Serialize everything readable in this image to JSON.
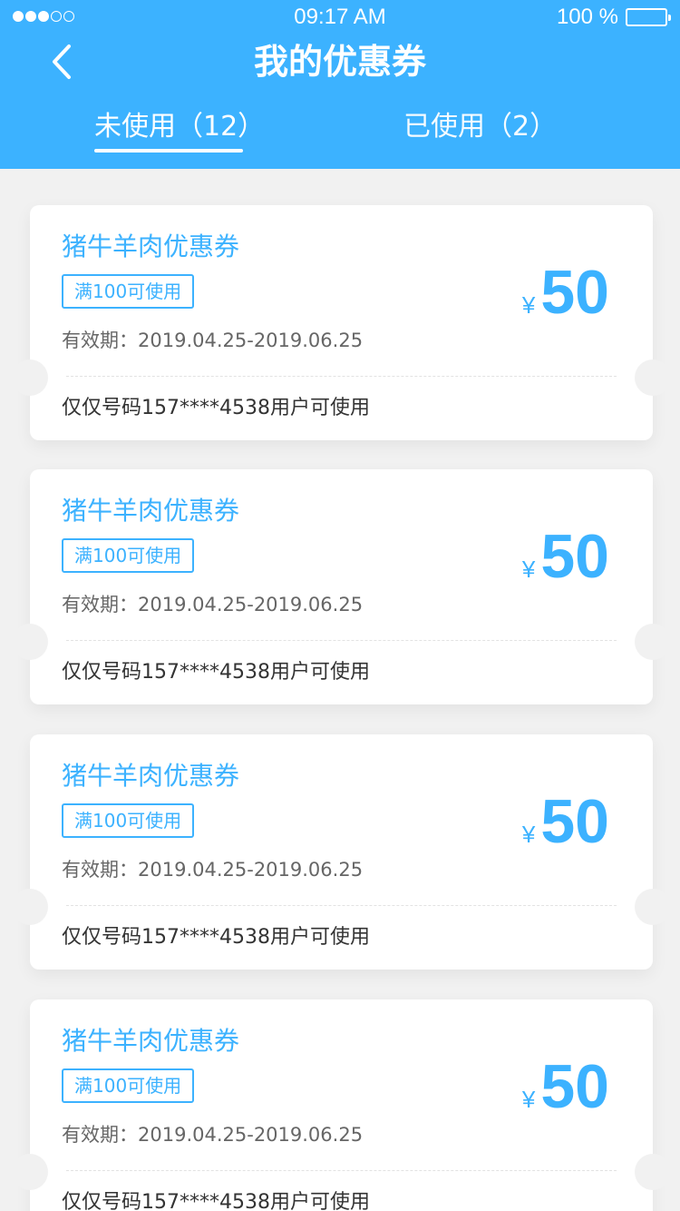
{
  "status_bar": {
    "time": "09:17 AM",
    "battery": "100 %"
  },
  "nav": {
    "title": "我的优惠券"
  },
  "tabs": {
    "unused": "未使用（12）",
    "used": "已使用（2）"
  },
  "coupons": [
    {
      "name": "猪牛羊肉优惠券",
      "condition": "满100可使用",
      "validity": "有效期：2019.04.25-2019.06.25",
      "currency": "¥",
      "amount": "50",
      "restriction": "仅仅号码157****4538用户可使用"
    },
    {
      "name": "猪牛羊肉优惠券",
      "condition": "满100可使用",
      "validity": "有效期：2019.04.25-2019.06.25",
      "currency": "¥",
      "amount": "50",
      "restriction": "仅仅号码157****4538用户可使用"
    },
    {
      "name": "猪牛羊肉优惠券",
      "condition": "满100可使用",
      "validity": "有效期：2019.04.25-2019.06.25",
      "currency": "¥",
      "amount": "50",
      "restriction": "仅仅号码157****4538用户可使用"
    },
    {
      "name": "猪牛羊肉优惠券",
      "condition": "满100可使用",
      "validity": "有效期：2019.04.25-2019.06.25",
      "currency": "¥",
      "amount": "50",
      "restriction": "仅仅号码157****4538用户可使用"
    }
  ],
  "colors": {
    "accent": "#3cb2ff",
    "background": "#f1f1f1"
  },
  "icons": {
    "back": "chevron-left-icon",
    "signal": "signal-dots-icon",
    "battery": "battery-icon"
  }
}
